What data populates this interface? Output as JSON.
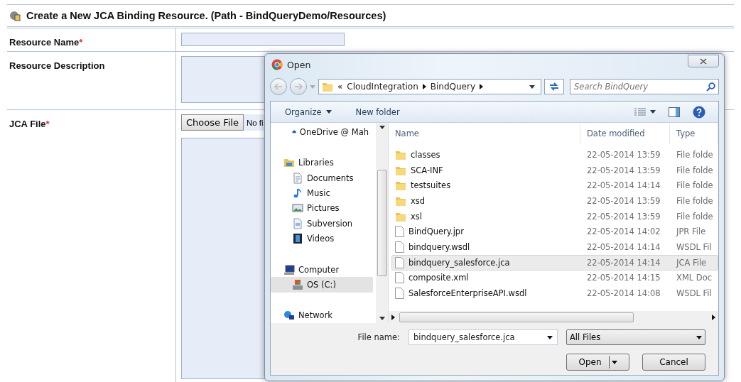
{
  "page": {
    "title": "Create a New JCA Binding Resource. (Path - BindQueryDemo/Resources)",
    "required_mark": "*"
  },
  "form": [
    {
      "label": "Resource Name",
      "required": true,
      "kind": "text"
    },
    {
      "label": "Resource Description",
      "required": false,
      "kind": "textarea"
    },
    {
      "label": "JCA File",
      "required": true,
      "kind": "file",
      "button": "Choose File",
      "status": "No fi"
    }
  ],
  "dialog": {
    "title": "Open",
    "address": {
      "overflow": "«",
      "crumbs": [
        "CloudIntegration",
        "BindQuery"
      ]
    },
    "search": {
      "placeholder": "Search BindQuery"
    },
    "toolbar": {
      "organize": "Organize",
      "new_folder": "New folder"
    },
    "nav": [
      {
        "label": "OneDrive @ Mah",
        "kind": "cloud",
        "selected": false
      },
      {
        "label": "Libraries",
        "kind": "library",
        "selected": false,
        "children": [
          {
            "label": "Documents",
            "kind": "documents",
            "selected": false
          },
          {
            "label": "Music",
            "kind": "music",
            "selected": false
          },
          {
            "label": "Pictures",
            "kind": "pictures",
            "selected": false
          },
          {
            "label": "Subversion",
            "kind": "subversion",
            "selected": false
          },
          {
            "label": "Videos",
            "kind": "videos",
            "selected": false
          }
        ]
      },
      {
        "label": "Computer",
        "kind": "computer",
        "selected": false,
        "children": [
          {
            "label": "OS (C:)",
            "kind": "drive",
            "selected": true
          }
        ]
      },
      {
        "label": "Network",
        "kind": "network",
        "selected": false
      }
    ],
    "columns": [
      "Name",
      "Date modified",
      "Type"
    ],
    "files": [
      {
        "name": "classes",
        "kind": "folder",
        "date": "22-05-2014 13:59",
        "type": "File folde",
        "selected": false
      },
      {
        "name": "SCA-INF",
        "kind": "folder",
        "date": "22-05-2014 13:59",
        "type": "File folde",
        "selected": false
      },
      {
        "name": "testsuites",
        "kind": "folder",
        "date": "22-05-2014 14:14",
        "type": "File folde",
        "selected": false
      },
      {
        "name": "xsd",
        "kind": "folder",
        "date": "22-05-2014 13:59",
        "type": "File folde",
        "selected": false
      },
      {
        "name": "xsl",
        "kind": "folder",
        "date": "22-05-2014 13:59",
        "type": "File folde",
        "selected": false
      },
      {
        "name": "BindQuery.jpr",
        "kind": "file",
        "date": "22-05-2014 14:02",
        "type": "JPR File",
        "selected": false
      },
      {
        "name": "bindquery.wsdl",
        "kind": "file",
        "date": "22-05-2014 14:14",
        "type": "WSDL Fil",
        "selected": false
      },
      {
        "name": "bindquery_salesforce.jca",
        "kind": "file",
        "date": "22-05-2014 14:14",
        "type": "JCA File",
        "selected": true
      },
      {
        "name": "composite.xml",
        "kind": "file",
        "date": "22-05-2014 14:15",
        "type": "XML Doc",
        "selected": false
      },
      {
        "name": "SalesforceEnterpriseAPI.wsdl",
        "kind": "file",
        "date": "22-05-2014 14:08",
        "type": "WSDL Fil",
        "selected": false
      }
    ],
    "file_name": {
      "label": "File name:",
      "value": "bindquery_salesforce.jca"
    },
    "filter": "All Files",
    "buttons": {
      "open": "Open",
      "cancel": "Cancel"
    }
  }
}
